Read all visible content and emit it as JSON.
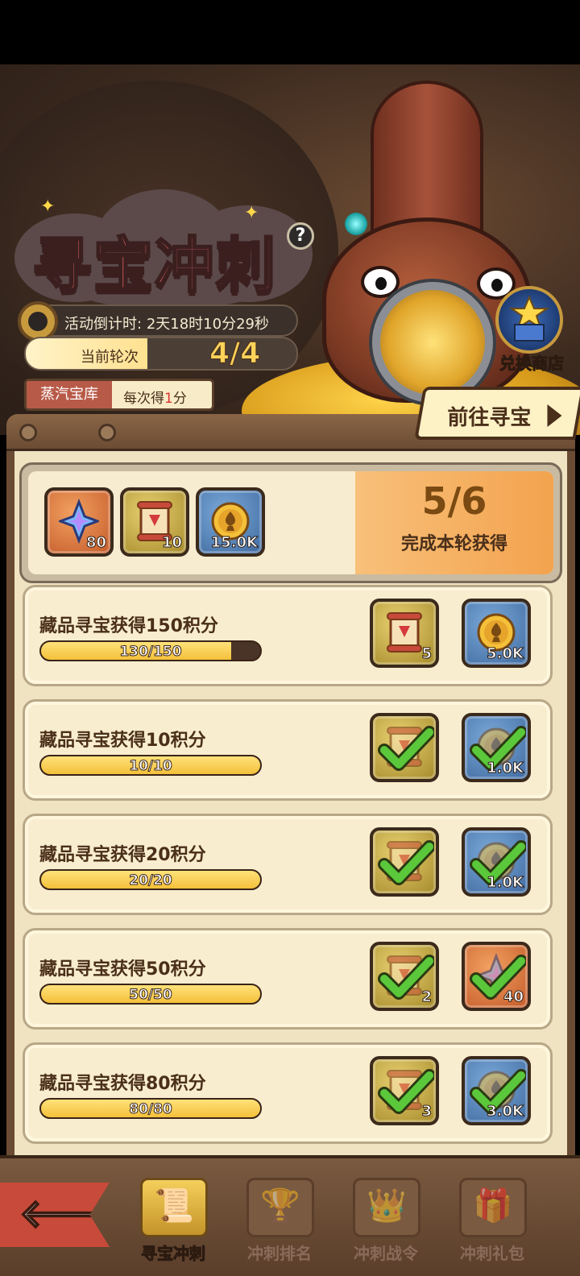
{
  "header": {
    "title": "寻宝冲刺",
    "help_icon": "?",
    "countdown_label": "活动倒计时:",
    "countdown_value": "2天18时10分29秒",
    "round_label": "当前轮次",
    "round_value": "4/4",
    "vault_name": "蒸汽宝库",
    "points_prefix": "每次得",
    "points_value": "1",
    "points_suffix": "分",
    "shop_label": "兑换商店",
    "goto_label": "前往寻宝"
  },
  "summary": {
    "rewards": [
      {
        "icon": "star-gem-icon",
        "qty": "80",
        "color": "orange"
      },
      {
        "icon": "scroll-icon",
        "qty": "10",
        "color": "gold"
      },
      {
        "icon": "gold-coin-icon",
        "qty": "15.0K",
        "color": "blue"
      }
    ],
    "progress": "5/6",
    "progress_label": "完成本轮获得",
    "progress_fraction": 0.833
  },
  "tasks": [
    {
      "title": "藏品寻宝获得150积分",
      "progress_text": "130/150",
      "current": 130,
      "target": 150,
      "rewards": [
        {
          "icon": "scroll-icon",
          "qty": "5",
          "color": "gold",
          "claimed": false
        },
        {
          "icon": "gold-coin-icon",
          "qty": "5.0K",
          "color": "blue",
          "claimed": false
        }
      ]
    },
    {
      "title": "藏品寻宝获得10积分",
      "progress_text": "10/10",
      "current": 10,
      "target": 10,
      "rewards": [
        {
          "icon": "scroll-icon",
          "qty": "",
          "color": "gold",
          "claimed": true
        },
        {
          "icon": "gold-coin-icon",
          "qty": "1.0K",
          "color": "blue",
          "claimed": true
        }
      ]
    },
    {
      "title": "藏品寻宝获得20积分",
      "progress_text": "20/20",
      "current": 20,
      "target": 20,
      "rewards": [
        {
          "icon": "scroll-icon",
          "qty": "",
          "color": "gold",
          "claimed": true
        },
        {
          "icon": "gold-coin-icon",
          "qty": "1.0K",
          "color": "blue",
          "claimed": true
        }
      ]
    },
    {
      "title": "藏品寻宝获得50积分",
      "progress_text": "50/50",
      "current": 50,
      "target": 50,
      "rewards": [
        {
          "icon": "scroll-icon",
          "qty": "2",
          "color": "gold",
          "claimed": true
        },
        {
          "icon": "star-gem-icon",
          "qty": "40",
          "color": "orange",
          "claimed": true
        }
      ]
    },
    {
      "title": "藏品寻宝获得80积分",
      "progress_text": "80/80",
      "current": 80,
      "target": 80,
      "rewards": [
        {
          "icon": "scroll-icon",
          "qty": "3",
          "color": "gold",
          "claimed": true
        },
        {
          "icon": "gold-coin-icon",
          "qty": "3.0K",
          "color": "blue",
          "claimed": true
        }
      ]
    }
  ],
  "nav": {
    "back_icon": "back-arrow-icon",
    "tabs": [
      {
        "label": "寻宝冲刺",
        "icon": "scroll-icon",
        "active": true
      },
      {
        "label": "冲刺排名",
        "icon": "trophy-icon",
        "active": false
      },
      {
        "label": "冲刺战令",
        "icon": "crown-icon",
        "active": false
      },
      {
        "label": "冲刺礼包",
        "icon": "gift-chest-icon",
        "active": false
      }
    ]
  },
  "colors": {
    "title_red": "#f46a6a",
    "bar_yellow": "#f4c03a",
    "check_green": "#5ac83a",
    "panel_brown": "#6a4b33"
  }
}
